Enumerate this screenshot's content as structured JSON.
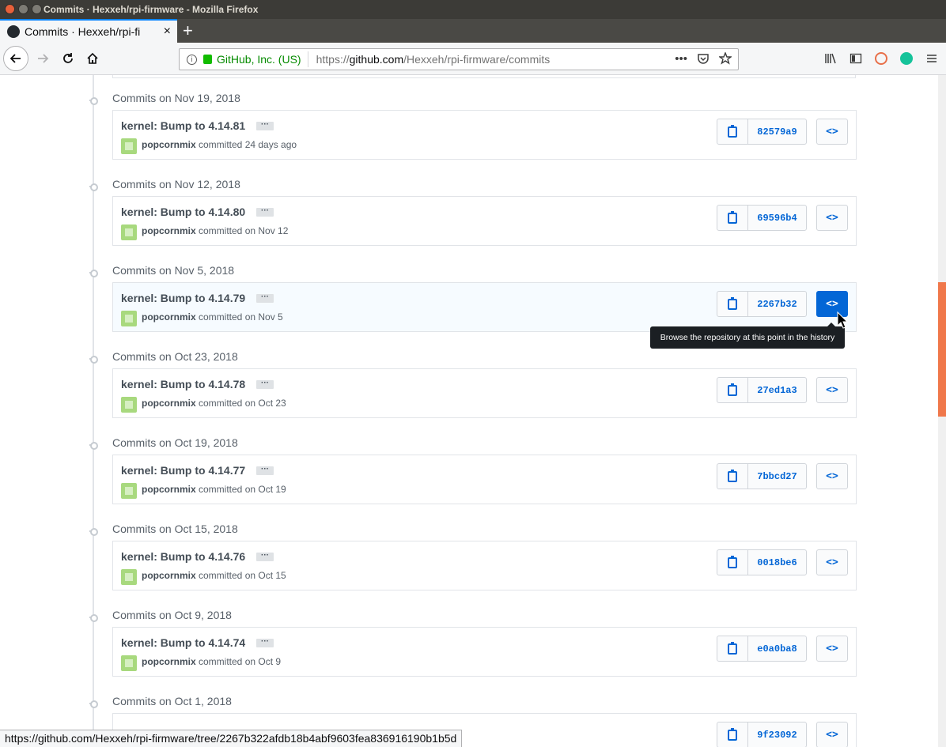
{
  "window": {
    "title": "Commits · Hexxeh/rpi-firmware - Mozilla Firefox"
  },
  "tab": {
    "label": "Commits · Hexxeh/rpi-fi",
    "close": "×",
    "new_tab": "+"
  },
  "urlbar": {
    "identity": "GitHub, Inc. (US)",
    "url_prefix": "https://",
    "url_domain": "github.com",
    "url_path": "/Hexxeh/rpi-firmware/commits",
    "more": "•••"
  },
  "commit_groups": [
    {
      "date": "Commits on Nov 19, 2018",
      "message": "kernel: Bump to 4.14.81",
      "author": "popcornmix",
      "when": " committed 24 days ago",
      "sha": "82579a9"
    },
    {
      "date": "Commits on Nov 12, 2018",
      "message": "kernel: Bump to 4.14.80",
      "author": "popcornmix",
      "when": " committed on Nov 12",
      "sha": "69596b4"
    },
    {
      "date": "Commits on Nov 5, 2018",
      "message": "kernel: Bump to 4.14.79",
      "author": "popcornmix",
      "when": " committed on Nov 5",
      "sha": "2267b32"
    },
    {
      "date": "Commits on Oct 23, 2018",
      "message": "kernel: Bump to 4.14.78",
      "author": "popcornmix",
      "when": " committed on Oct 23",
      "sha": "27ed1a3"
    },
    {
      "date": "Commits on Oct 19, 2018",
      "message": "kernel: Bump to 4.14.77",
      "author": "popcornmix",
      "when": " committed on Oct 19",
      "sha": "7bbcd27"
    },
    {
      "date": "Commits on Oct 15, 2018",
      "message": "kernel: Bump to 4.14.76",
      "author": "popcornmix",
      "when": " committed on Oct 15",
      "sha": "0018be6"
    },
    {
      "date": "Commits on Oct 9, 2018",
      "message": "kernel: Bump to 4.14.74",
      "author": "popcornmix",
      "when": " committed on Oct 9",
      "sha": "e0a0ba8"
    },
    {
      "date": "Commits on Oct 1, 2018",
      "message": "",
      "author": "",
      "when": "",
      "sha": "9f23092"
    }
  ],
  "ellipsis_label": "···",
  "browse_label": "<>",
  "tooltip": "Browse the repository at this point in the history",
  "status_url": "https://github.com/Hexxeh/rpi-firmware/tree/2267b322afdb18b4abf9603fea836916190b1b5d",
  "colors": {
    "link": "#0366d6",
    "accent": "#0a84ff",
    "secure": "#058b00"
  }
}
